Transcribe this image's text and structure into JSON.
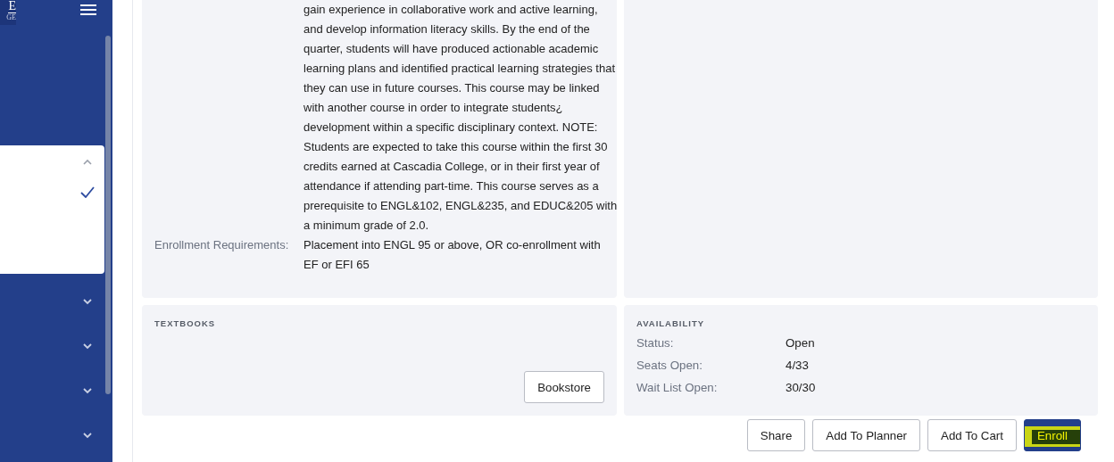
{
  "sidebar": {
    "logo": {
      "line_1": "E",
      "line_2": "GE"
    },
    "dropdown": {
      "expanded": true,
      "options": [
        {
          "selected": true
        }
      ]
    },
    "sections": [
      {
        "expanded": false
      },
      {
        "expanded": false
      },
      {
        "expanded": false
      },
      {
        "expanded": false
      }
    ]
  },
  "details": {
    "description": "gain experience in collaborative work and active learning, and develop information literacy skills. By the end of the quarter, students will have produced actionable academic learning plans and identified practical learning strategies that they can use in future courses. This course may be linked with another course in order to integrate students¿ development within a specific disciplinary context. NOTE: Students are expected to take this course within the first 30 credits earned at Cascadia College, or in their first year of attendance if attending part-time. This course serves as a prerequisite to ENGL&102, ENGL&235, and EDUC&205 with a minimum grade of 2.0.",
    "fields": [
      {
        "label": "Enrollment Requirements:",
        "value": "Placement into ENGL 95 or above, OR co-enrollment with EF or EFI 65"
      }
    ]
  },
  "textbooks": {
    "heading": "TEXTBOOKS",
    "button": "Bookstore"
  },
  "availability": {
    "heading": "AVAILABILITY",
    "rows": [
      {
        "label": "Status:",
        "value": "Open"
      },
      {
        "label": "Seats Open:",
        "value": "4/33"
      },
      {
        "label": "Wait List Open:",
        "value": "30/30"
      }
    ]
  },
  "actions": [
    {
      "label": "Share",
      "kind": "secondary",
      "highlighted": false
    },
    {
      "label": "Add To Planner",
      "kind": "secondary",
      "highlighted": false
    },
    {
      "label": "Add To Cart",
      "kind": "secondary",
      "highlighted": false
    },
    {
      "label": "Enroll",
      "kind": "primary",
      "highlighted": true
    }
  ]
}
